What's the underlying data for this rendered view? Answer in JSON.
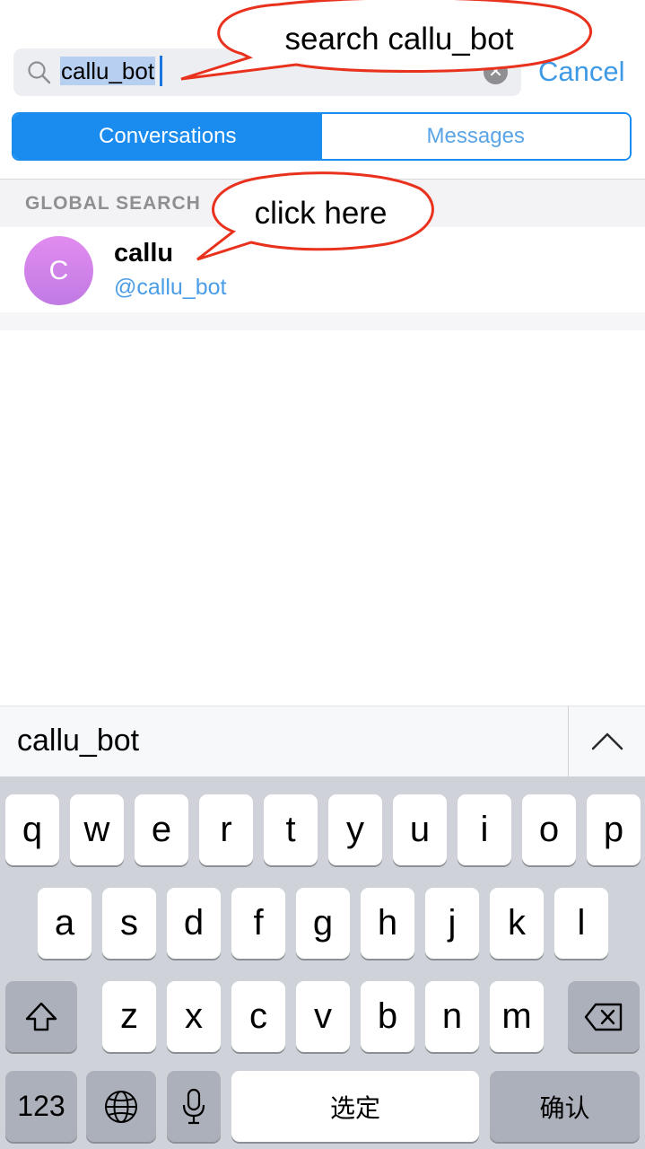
{
  "search": {
    "query": "callu_bot",
    "cancel_label": "Cancel"
  },
  "tabs": {
    "conversations": "Conversations",
    "messages": "Messages"
  },
  "section": {
    "title": "GLOBAL SEARCH"
  },
  "result": {
    "avatar_letter": "C",
    "name": "callu",
    "handle": "@callu_bot"
  },
  "callouts": {
    "search": "search callu_bot",
    "click": "click here"
  },
  "suggestion": {
    "word": "callu_bot"
  },
  "keyboard": {
    "row1": [
      "q",
      "w",
      "e",
      "r",
      "t",
      "y",
      "u",
      "i",
      "o",
      "p"
    ],
    "row2": [
      "a",
      "s",
      "d",
      "f",
      "g",
      "h",
      "j",
      "k",
      "l"
    ],
    "row3": [
      "z",
      "x",
      "c",
      "v",
      "b",
      "n",
      "m"
    ],
    "numbers_label": "123",
    "space_label": "选定",
    "confirm_label": "确认"
  },
  "colors": {
    "accent": "#1a8cf0",
    "callout_border": "#e8321e",
    "avatar": "#d584ea"
  }
}
